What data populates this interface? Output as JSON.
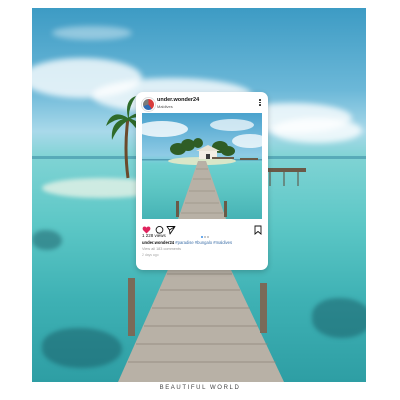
{
  "post": {
    "username": "under.wonder24",
    "location": "Maldives",
    "likes": "1 228 views",
    "caption_user": "under.wonder24",
    "caption_tags": "#paradise #bungalo #maldives",
    "comments": "View all 183 comments",
    "time": "2 days ago"
  },
  "icons": [
    "heart-icon",
    "comment-icon",
    "share-icon",
    "bookmark-icon",
    "more-icon"
  ],
  "colors": {
    "heart": "#e0245e",
    "tags": "#3d6fa8",
    "water": "#5cc7c6"
  },
  "footer": {
    "caption": "BEAUTIFUL WORLD"
  }
}
